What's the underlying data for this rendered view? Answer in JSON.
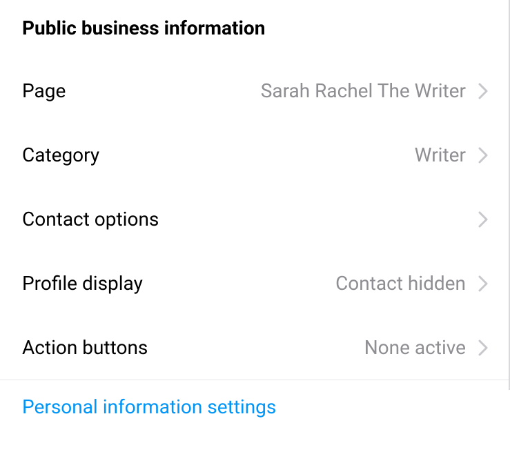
{
  "section": {
    "title": "Public business information"
  },
  "rows": {
    "page": {
      "label": "Page",
      "value": "Sarah Rachel The Writer"
    },
    "category": {
      "label": "Category",
      "value": "Writer"
    },
    "contact_options": {
      "label": "Contact options",
      "value": ""
    },
    "profile_display": {
      "label": "Profile display",
      "value": "Contact hidden"
    },
    "action_buttons": {
      "label": "Action buttons",
      "value": "None active"
    }
  },
  "link": {
    "personal_info": "Personal information settings"
  }
}
